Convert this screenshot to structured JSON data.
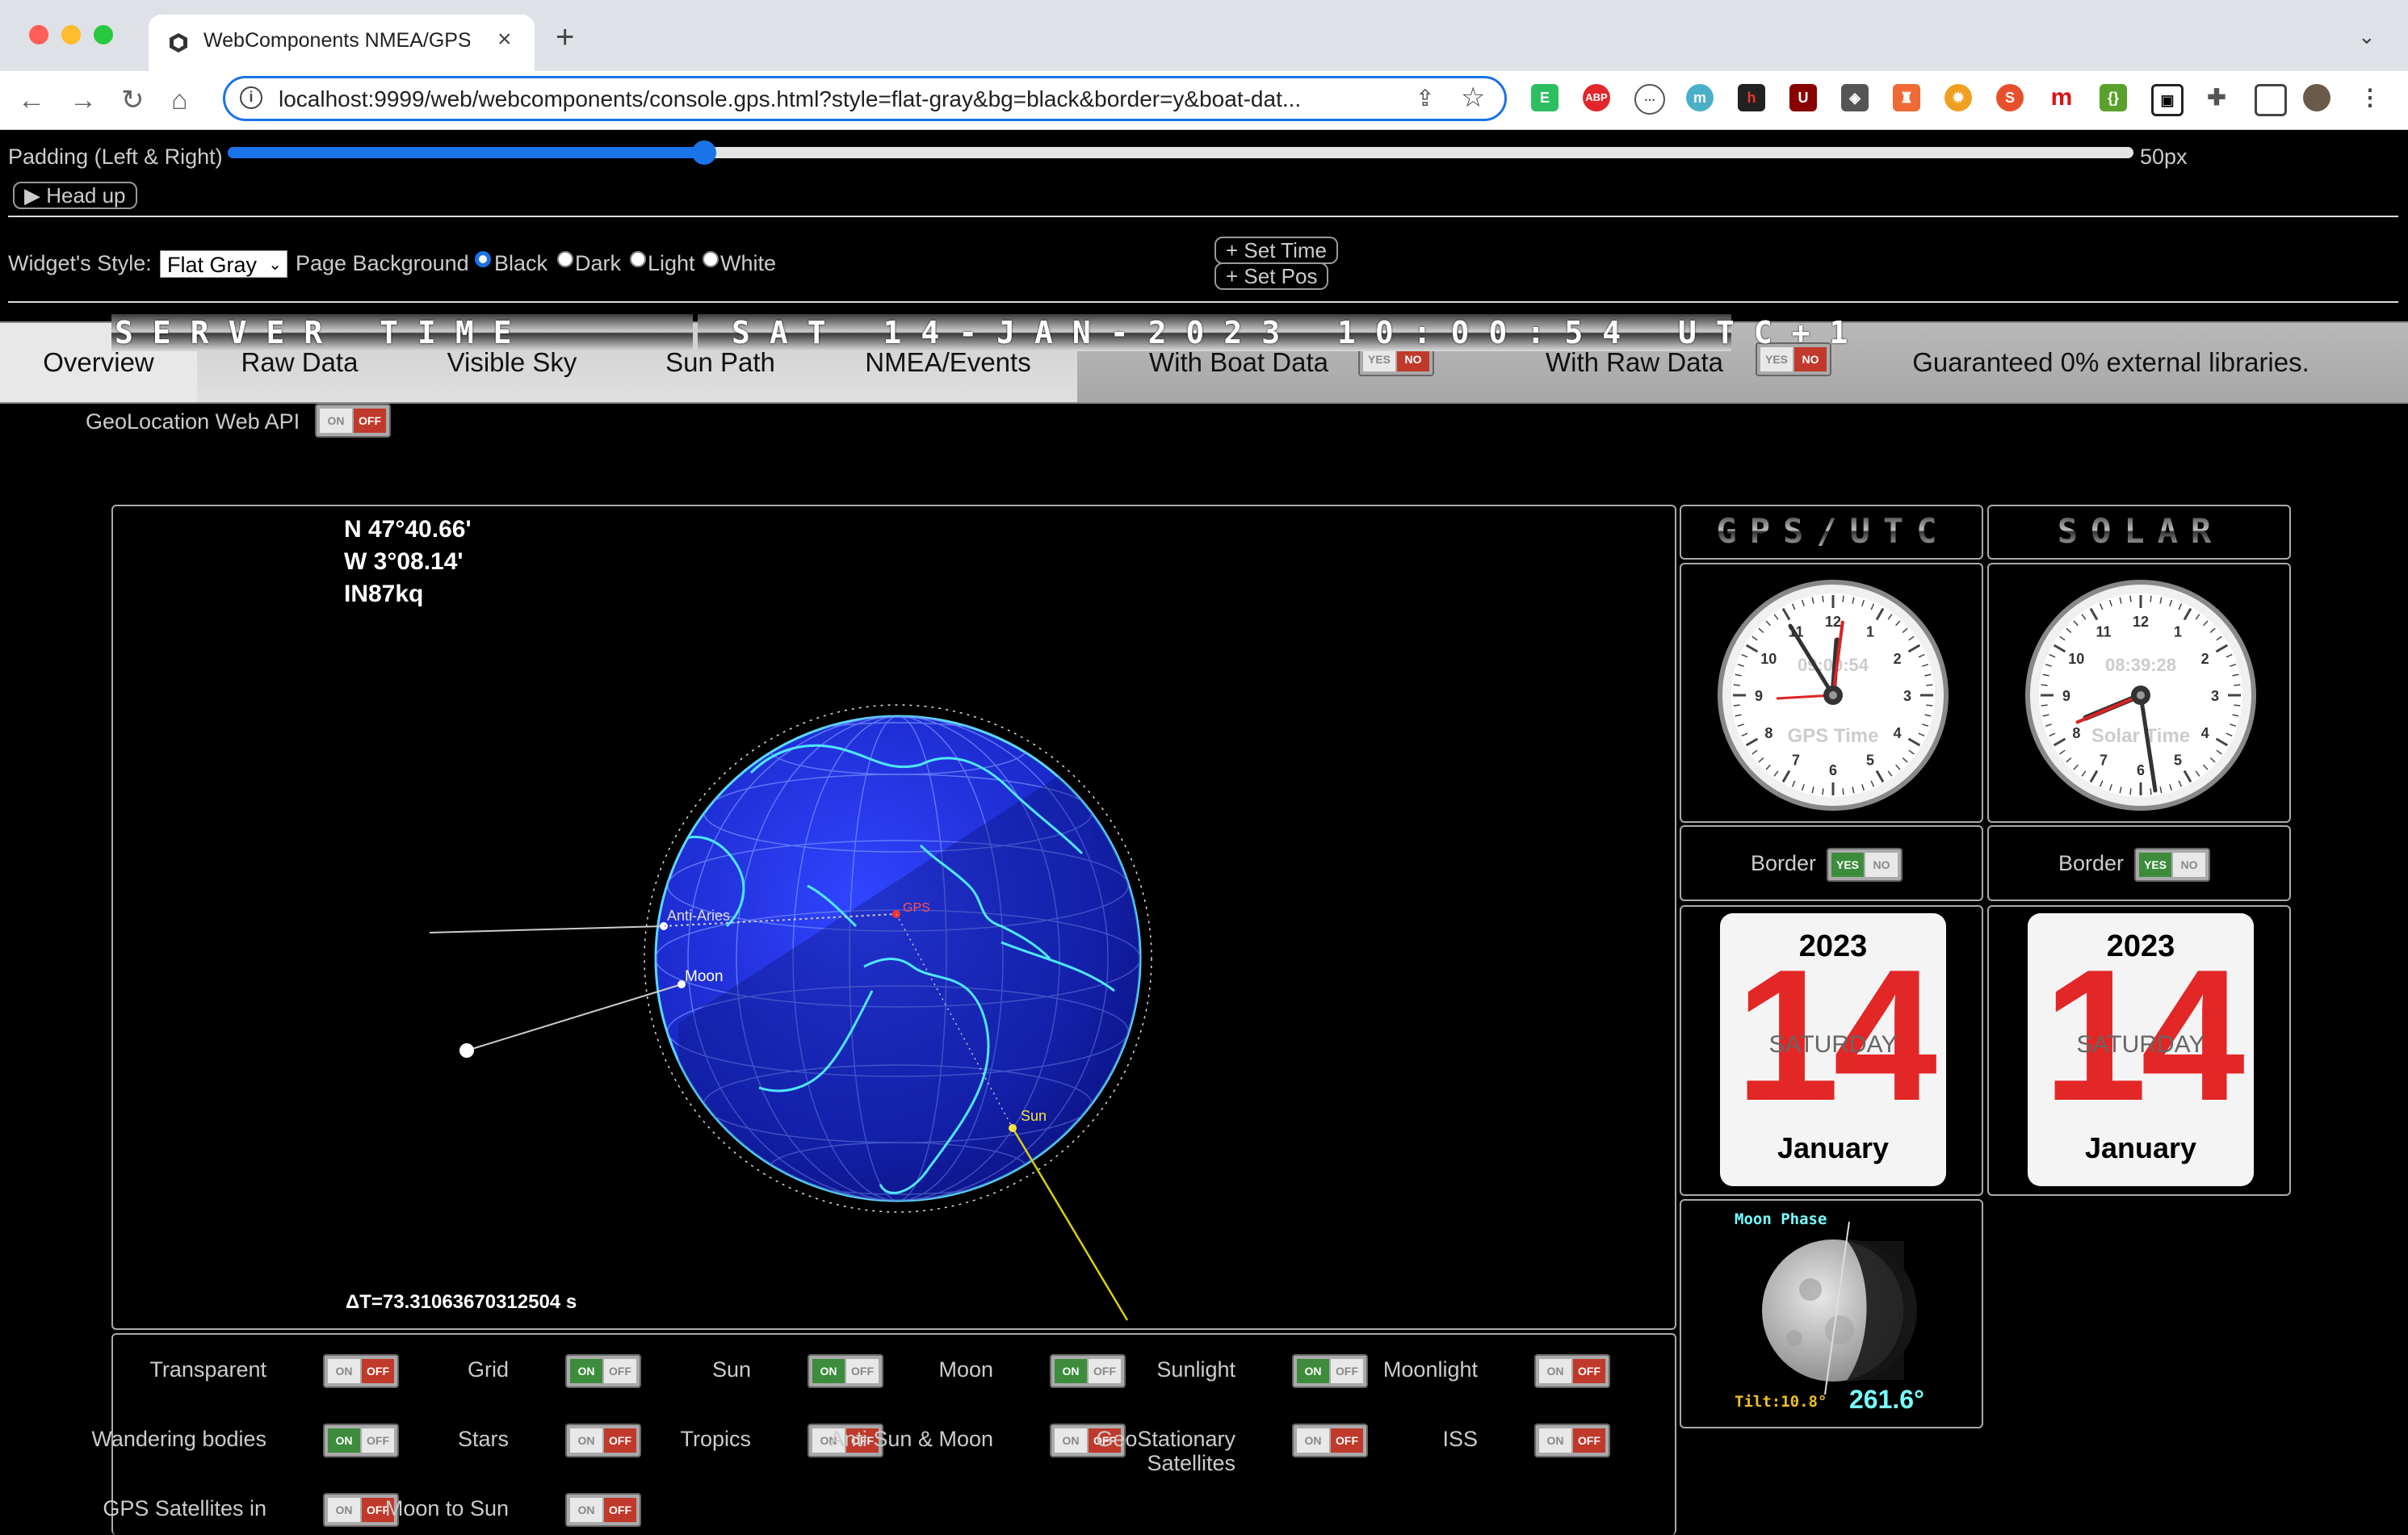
{
  "browser": {
    "tab_title": "WebComponents NMEA/GPS C",
    "url": "localhost:9999/web/webcomponents/console.gps.html?style=flat-gray&bg=black&border=y&boat-dat..."
  },
  "controls": {
    "padding_label": "Padding (Left & Right)",
    "padding_value": "50px",
    "padding_fraction": 0.25,
    "head_up": "▶ Head up",
    "widget_style_label": "Widget's Style:",
    "widget_style_value": "Flat Gray",
    "page_bg_label": "Page Background",
    "bg_options": [
      "Black",
      "Dark",
      "Light",
      "White"
    ],
    "bg_selected": "Black",
    "set_time": "+ Set Time",
    "set_pos": "+ Set Pos"
  },
  "tabs": [
    "Overview",
    "Raw Data",
    "Visible Sky",
    "Sun Path",
    "NMEA/Events"
  ],
  "active_tab": "Overview",
  "boat_data_label": "With Boat Data",
  "raw_data_label": "With Raw Data",
  "guarantee": "Guaranteed 0% external libraries.",
  "toggle_text": {
    "yes": "YES",
    "no": "NO",
    "on": "ON",
    "off": "OFF"
  },
  "geolocation_label": "GeoLocation Web API",
  "server_time": {
    "label": "SERVER TIME",
    "value": "SAT 14-JAN-2023 10:00:54 UTC+1"
  },
  "globe": {
    "lat": "N 47°40.66'",
    "lng": "W 3°08.14'",
    "grid": "IN87kq",
    "delta_t": "ΔT=73.31063670312504 s",
    "labels": {
      "anti_aries": "Anti-Aries",
      "moon": "Moon",
      "sun": "Sun",
      "gps": "GPS"
    }
  },
  "clocks": {
    "gps": {
      "header": "GPS/UTC",
      "digital": "09:00:54",
      "caption": "GPS Time"
    },
    "solar": {
      "header": "SOLAR",
      "digital": "08:39:28",
      "caption": "Solar Time"
    },
    "border_label": "Border"
  },
  "calendar": {
    "year": "2023",
    "day": "14",
    "dow": "SATURDAY",
    "month": "January"
  },
  "moon_phase": {
    "title": "Moon Phase",
    "tilt": "Tilt:10.8°",
    "angle": "261.6°"
  },
  "options": [
    {
      "label": "Transparent",
      "state": "off"
    },
    {
      "label": "Grid",
      "state": "on"
    },
    {
      "label": "Sun",
      "state": "on"
    },
    {
      "label": "Moon",
      "state": "on"
    },
    {
      "label": "Sunlight",
      "state": "on"
    },
    {
      "label": "Moonlight",
      "state": "off"
    },
    {
      "label": "Wandering bodies",
      "state": "on"
    },
    {
      "label": "Stars",
      "state": "off"
    },
    {
      "label": "Tropics",
      "state": "off"
    },
    {
      "label": "Anti Sun & Moon",
      "state": "off"
    },
    {
      "label": "GeoStationary Satellites",
      "state": "off"
    },
    {
      "label": "ISS",
      "state": "off"
    },
    {
      "label": "GPS Satellites in",
      "state": "off"
    },
    {
      "label": "Moon to Sun",
      "state": "off"
    }
  ],
  "colors": {
    "accent": "#1a73e8",
    "label_cyan": "#77ffff",
    "globe": "#1d2fd0",
    "coast": "#4fe7ff",
    "red": "#e32626"
  }
}
